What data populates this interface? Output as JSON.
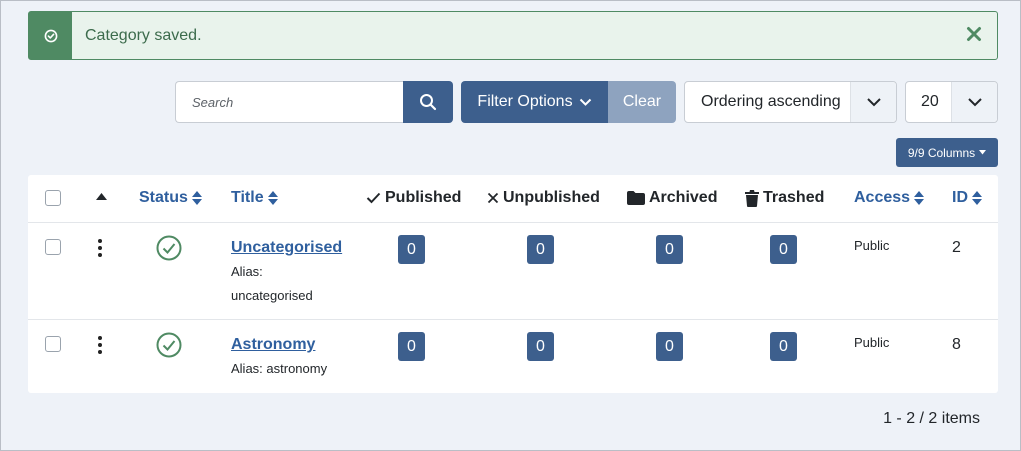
{
  "alert": {
    "message": "Category saved."
  },
  "toolbar": {
    "search_placeholder": "Search",
    "filter_options_label": "Filter Options",
    "clear_label": "Clear",
    "ordering_value": "Ordering ascending",
    "limit_value": "20",
    "columns_label": "9/9 Columns"
  },
  "table": {
    "headers": {
      "status": "Status",
      "title": "Title",
      "published": "Published",
      "unpublished": "Unpublished",
      "archived": "Archived",
      "trashed": "Trashed",
      "access": "Access",
      "id": "ID"
    },
    "rows": [
      {
        "title": "Uncategorised",
        "alias_label": "Alias:",
        "alias_value": "uncategorised",
        "published": "0",
        "unpublished": "0",
        "archived": "0",
        "trashed": "0",
        "access": "Public",
        "id": "2"
      },
      {
        "title": "Astronomy",
        "alias_text": "Alias: astronomy",
        "published": "0",
        "unpublished": "0",
        "archived": "0",
        "trashed": "0",
        "access": "Public",
        "id": "8"
      }
    ]
  },
  "pagination": {
    "info": "1 - 2 / 2 items"
  },
  "icons": {
    "alert": "check-circle-icon",
    "close": "close-icon",
    "search": "search-icon",
    "sort_up": "sort-asc-icon",
    "sort": "sort-icon",
    "published": "check-icon",
    "unpublished": "times-icon",
    "archived": "folder-icon",
    "trashed": "trash-icon",
    "status": "published-check-icon",
    "row_actions": "kebab-icon"
  },
  "colors": {
    "primary": "#3d5f8d",
    "success": "#4f8a63",
    "link": "#2f5f9e",
    "clear": "#8ea3bf"
  }
}
